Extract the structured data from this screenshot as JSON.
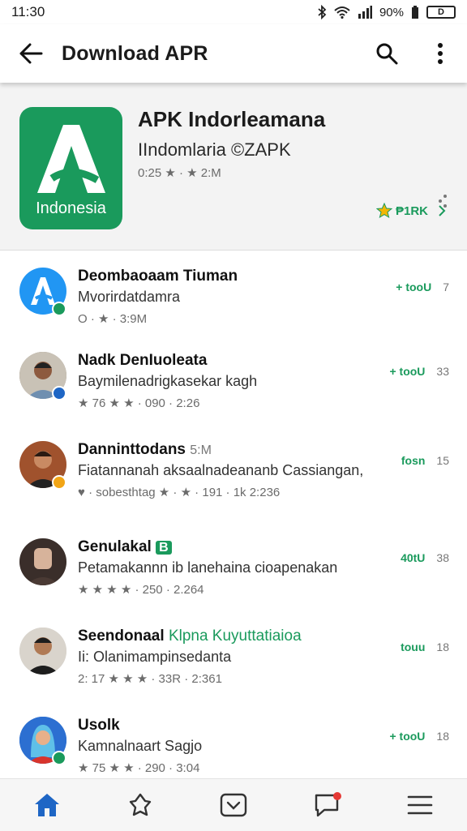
{
  "status": {
    "time": "11:30",
    "battery_pct": "90%",
    "battery_icon": "D"
  },
  "appbar": {
    "title": "Download APR"
  },
  "hero": {
    "title": "APK Indorleamana",
    "subtitle": "IIndomlaria ©ZAPK",
    "meta": "0:25 ★ · ★ 2:M",
    "logo_text": "Indonesia",
    "badge_label": "₱1RK",
    "badge_color": "#1a9a5c"
  },
  "items": [
    {
      "name": "Deombaoaam Tiuman",
      "name_tag": "",
      "sub": "Mvorirdatdamra",
      "meta": "O · ★ · 3:9M",
      "right": "+ tooU",
      "count": "7"
    },
    {
      "name": "Nadk DenIuoleata",
      "name_tag": "",
      "sub": "Baymilenadrigkasekar kagh",
      "meta": "★ 76 ★ ★ · 090 · 2:26",
      "right": "+ tooU",
      "count": "33"
    },
    {
      "name": "Danninttodans",
      "name_tag": "5:M",
      "sub": "Fiatannanah aksaalnadeananb Cassiangan,",
      "meta": "♥ · sobesthtag ★ · ★ · 191 · 1k 2:236",
      "right": "fosn",
      "count": "15"
    },
    {
      "name": "Genulakal",
      "name_tag": "B",
      "sub": "Petamakannn ib lanehaina cioapenakan",
      "meta": "★ ★ ★ ★ · 250 · 2.264",
      "right": "40tU",
      "count": "38"
    },
    {
      "name": "Seendonaal",
      "name_tag": "Klpna Kuyuttatiaioa",
      "sub": "Ii: Olanimampinsedanta",
      "meta": "2: 17 ★ ★ ★ · 33R · 2:361",
      "right": "touu",
      "count": "18"
    },
    {
      "name": "Usolk",
      "name_tag": "",
      "sub": "Kamnalnaart Sagjo",
      "meta": "★ 75 ★ ★ · 290 · 3:04",
      "right": "+ tooU",
      "count": "18"
    }
  ],
  "nav": {
    "items": [
      "home-icon",
      "pin-icon",
      "inbox-icon",
      "chat-icon",
      "menu-icon"
    ],
    "accent": "#1e66c5"
  }
}
